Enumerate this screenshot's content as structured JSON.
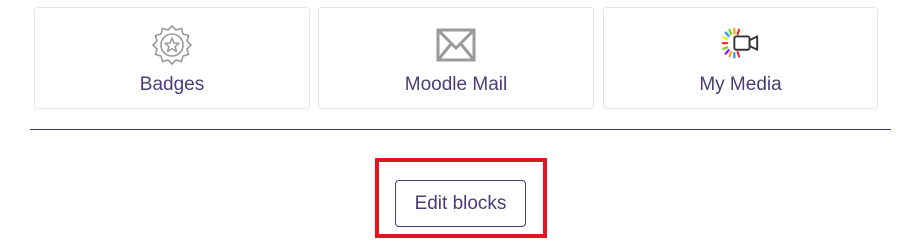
{
  "tiles": [
    {
      "label": "Badges",
      "icon": "badge-icon"
    },
    {
      "label": "Moodle Mail",
      "icon": "mail-icon"
    },
    {
      "label": "My Media",
      "icon": "video-camera-icon"
    }
  ],
  "edit_blocks": {
    "label": "Edit blocks"
  },
  "colors": {
    "text": "#4c3d75",
    "divider": "#4d2e6b",
    "highlight": "#e0151f",
    "tile_border": "#e6e6e6"
  }
}
